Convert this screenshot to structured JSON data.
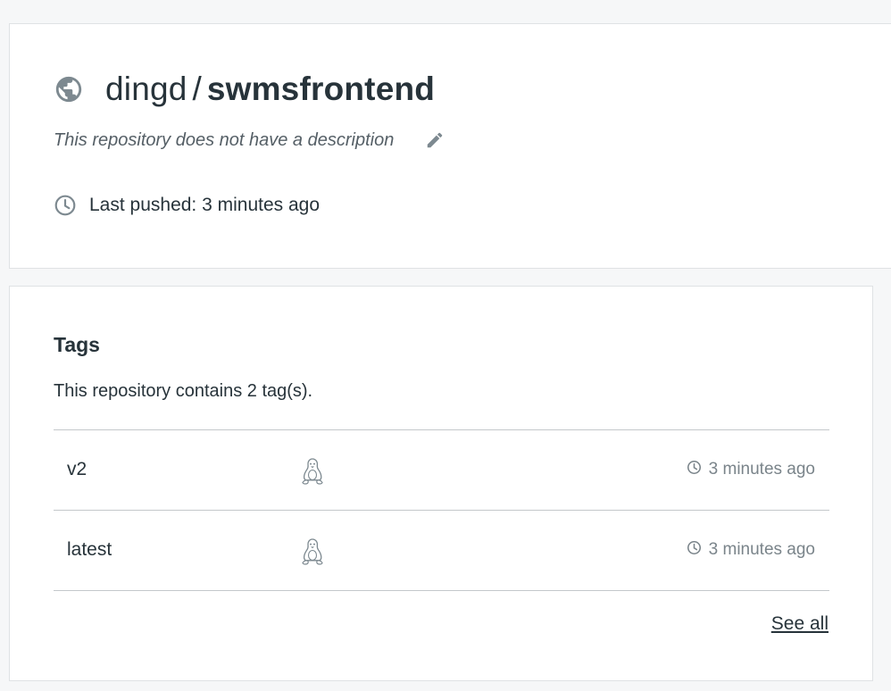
{
  "repo": {
    "namespace": "dingd",
    "separator": "/",
    "name": "swmsfrontend",
    "visibility_icon": "globe-icon",
    "description": "This repository does not have a description",
    "edit_icon": "pencil-icon",
    "last_pushed": "Last pushed: 3 minutes ago"
  },
  "tags": {
    "heading": "Tags",
    "count_text": "This repository contains 2 tag(s).",
    "rows": [
      {
        "name": "v2",
        "os_icon": "linux-tux-icon",
        "time": "3 minutes ago"
      },
      {
        "name": "latest",
        "os_icon": "linux-tux-icon",
        "time": "3 minutes ago"
      }
    ],
    "see_all": "See all"
  },
  "colors": {
    "background": "#f6f7f8",
    "card": "#ffffff",
    "text": "#27333a",
    "muted": "#7a848a",
    "icon": "#7d8990"
  }
}
